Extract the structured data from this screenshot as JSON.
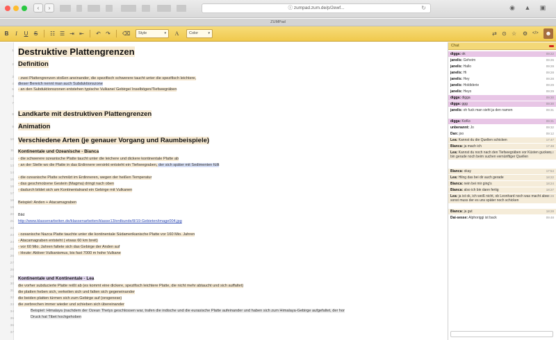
{
  "browser": {
    "url": "ⓘ zumpad.zum.de/p/2ewf...",
    "tab_title": "ZUMPad",
    "colors": {
      "close": "#fe5f57",
      "minimize": "#febc2e",
      "zoom": "#28c840"
    }
  },
  "toolbar": {
    "bold": "B",
    "italic": "I",
    "underline": "U",
    "strike": "S",
    "ol": "☷",
    "ul": "☰",
    "indent": "⇥",
    "outdent": "⇤",
    "undo": "↶",
    "redo": "↷",
    "eraser": "⌫",
    "style_select": "Style",
    "font_size": "A",
    "color_select": "Color",
    "history_icon": "⇄",
    "clock_icon": "⊙",
    "star_icon": "☆",
    "settings_icon": "⚙",
    "embed_icon": "</>",
    "users_icon": "☻"
  },
  "editor": {
    "line_numbers": [
      "1",
      "2",
      "3",
      "4",
      "5",
      "6",
      "7",
      "8",
      "9",
      "10",
      "11",
      "12",
      "13",
      "14",
      "15",
      "16",
      "17",
      "18",
      "19",
      "20",
      "21",
      "22",
      "23",
      "24",
      "25",
      "26",
      "27",
      "28",
      "29",
      "30",
      "31",
      "32",
      "33",
      "34",
      "35",
      "36",
      "37",
      "38",
      "39",
      "40",
      "41",
      "42",
      "43"
    ],
    "title": "Destruktive Plattengrenzen",
    "definition_heading": "Definition",
    "def_lines": [
      "- zwei Plattengrenzen stoßen aneinander, die spezifisch schwerere taucht unter die spezifisch leichtere,",
      "dieser Bereich nennt man auch Subduktionszone",
      "- an den Subduktionszonen entstehen typische Vulkane/ Gebirge/ Inselbögen/Tiefseegräben"
    ],
    "map_heading": "Landkarte mit destruktiven Plattengrenzen",
    "animation_heading": "Animation",
    "types_heading": "Verschiedene Arten (je genauer Vorgang und Raumbeispiele)",
    "oceanic_heading": "Kontinentale und Ozeanische - Bianca",
    "oceanic_lines": [
      "- die schwerere ozeanische Platte taucht unter die leichere und dickere kontinentale Platte ab",
      "- an der Stelle wo die Platte in das Erdinnere versinkt entsteht ein Tiefseegraben,",
      " der sich später mit Sedimenten füllt",
      "- die ozeanische Platte schmilzt im Erdinneren, wegen der heißen Temperatur",
      "- das geschmolzene Gestein (Magma) dringt nach oben",
      "- dadurch bildet sich am Kontinentalrand ein Gebirge mit Vulkanen"
    ],
    "example1": "Beispiel: Anden + Atacamagraben",
    "bild_label": "Bild",
    "bild_link": "http://www.klassenarbeiten.de/klassenarbeiten/klasse13/erdkunde/8/19-Gebieten/image004.jpg",
    "nazca_lines": [
      "- ozeanische Nazca Platte tauchte unter die kontinentale Südamerikanische Platte vor 160 Mio. Jahren",
      "- Atacamagraben entsteht ( etwas 60 km breit)",
      "- vor 60 Mio. Jahren faltete sich das Gebirge der Anden auf",
      "- Heute: Aktiver Vulkanismus, bis fast 7000 m hohe Vulkane"
    ],
    "continental_heading": "Kontinentale und Kontinentale - Lea",
    "continental_lines": [
      "die vorher subducierte Platte reißt ab (es kommt eine dickere, spezifisch leichtere Platte, die nicht mehr abtaucht und sich auffaltet)",
      "die platten heben sich, verkeilen sich und falten sich gegeneinander",
      "die beiden platten türmen sich zum Gebirge auf (orogenese)",
      "die zerbrechen immer wieder und schieben sich übereinander"
    ],
    "example2_lines": [
      "Beispiel: Himalaya (nachdem der Ozean Thetys geschlossen war, trafen die indische und die eurasische Platte aufeinander und haben sich zum Himalaya-Gebirge aufgefaltet, der hor",
      "Druck hat Tibet hochgehoben"
    ]
  },
  "chat": {
    "title": "Chat",
    "messages": [
      {
        "author": "digga:",
        "text": "ok",
        "time": "09:22"
      },
      {
        "author": "janelis:",
        "text": "Geheim",
        "time": "09:26"
      },
      {
        "author": "janelis:",
        "text": "Hallo",
        "time": "09:28"
      },
      {
        "author": "janelis:",
        "text": "Hi",
        "time": "09:28"
      },
      {
        "author": "janelis:",
        "text": "Hey",
        "time": "09:28"
      },
      {
        "author": "janelis:",
        "text": "Holdiderie",
        "time": "09:29"
      },
      {
        "author": "janelis:",
        "text": "Heyo",
        "time": "09:29"
      },
      {
        "author": "digga:",
        "text": "digga",
        "time": "09:30"
      },
      {
        "author": "digga:",
        "text": "ggg",
        "time": "09:30"
      },
      {
        "author": "janelis:",
        "text": "oh fuck man sieht ja den namen",
        "time": "09:31"
      },
      {
        "author": "digga:",
        "text": "KoKo",
        "time": "09:31"
      },
      {
        "author": "unbenannt:",
        "text": "Jo",
        "time": "09:32"
      },
      {
        "author": "Dan:",
        "text": "joo",
        "time": "09:12"
      },
      {
        "author": "Lea:",
        "text": "Kannst du die Quellen schicken",
        "time": "17:47"
      },
      {
        "author": "Bianca:",
        "text": "ja mach ich",
        "time": "17:48"
      },
      {
        "author": "Lea:",
        "text": "Kannst du noch nach den Tiefseegräben vor Küsten gucken, bin gerade noch beim suchen vernünftiger Quellen",
        "time": "17:52"
      },
      {
        "author": "Bianca:",
        "text": "okay",
        "time": "17:54"
      },
      {
        "author": "Lea:",
        "text": "Hilng das bei dir auch gerade",
        "time": "18:22"
      },
      {
        "author": "Bianca:",
        "text": "nein bei mir ging's",
        "time": "18:24"
      },
      {
        "author": "Bianca:",
        "text": "also ich bin dann fertig",
        "time": "18:27"
      },
      {
        "author": "Lea:",
        "text": "ja ist ok, ich weiß nicht, ob Leonhard noch was macht aber sonst muss der es uns später noch schicken",
        "time": "18:28"
      },
      {
        "author": "Bianca:",
        "text": "ja gut",
        "time": "18:28"
      },
      {
        "author": "Dai-sesse:",
        "text": "Alphoriggi ist back",
        "time": "09:48"
      }
    ]
  }
}
